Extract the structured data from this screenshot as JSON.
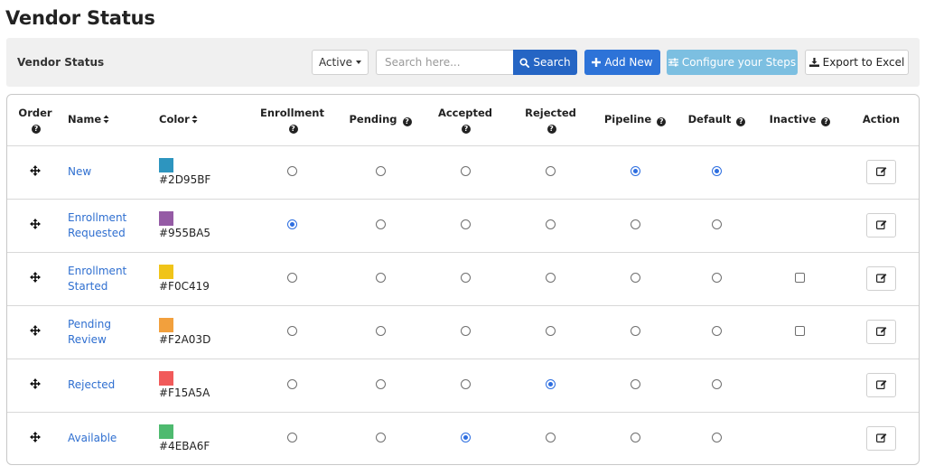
{
  "page": {
    "title": "Vendor Status"
  },
  "toolbar": {
    "label": "Vendor Status",
    "status_filter": "Active",
    "search_placeholder": "Search here...",
    "search_label": "Search",
    "add_new_label": "Add New",
    "configure_label": "Configure your Steps",
    "export_label": "Export to Excel"
  },
  "colors": {
    "primary": "#2565c4",
    "add_new": "#2d73d8",
    "configure": "#7cbfe1",
    "link": "#2f6fd0"
  },
  "table": {
    "headers": {
      "order": "Order",
      "name": "Name",
      "color": "Color",
      "enrollment": "Enrollment",
      "pending": "Pending",
      "accepted": "Accepted",
      "rejected": "Rejected",
      "pipeline": "Pipeline",
      "default": "Default",
      "inactive": "Inactive",
      "action": "Action"
    },
    "rows": [
      {
        "name_line1": "New",
        "name_line2": "",
        "color_hex": "#2D95BF",
        "enrollment": false,
        "pending": false,
        "accepted": false,
        "rejected": false,
        "pipeline": true,
        "default": true,
        "inactive_visible": false
      },
      {
        "name_line1": "Enrollment",
        "name_line2": "Requested",
        "color_hex": "#955BA5",
        "enrollment": true,
        "pending": false,
        "accepted": false,
        "rejected": false,
        "pipeline": false,
        "default": false,
        "inactive_visible": false
      },
      {
        "name_line1": "Enrollment",
        "name_line2": "Started",
        "color_hex": "#F0C419",
        "enrollment": false,
        "pending": false,
        "accepted": false,
        "rejected": false,
        "pipeline": false,
        "default": false,
        "inactive_visible": true
      },
      {
        "name_line1": "Pending",
        "name_line2": "Review",
        "color_hex": "#F2A03D",
        "enrollment": false,
        "pending": false,
        "accepted": false,
        "rejected": false,
        "pipeline": false,
        "default": false,
        "inactive_visible": true
      },
      {
        "name_line1": "Rejected",
        "name_line2": "",
        "color_hex": "#F15A5A",
        "enrollment": false,
        "pending": false,
        "accepted": false,
        "rejected": true,
        "pipeline": false,
        "default": false,
        "inactive_visible": false
      },
      {
        "name_line1": "Available",
        "name_line2": "",
        "color_hex": "#4EBA6F",
        "enrollment": false,
        "pending": false,
        "accepted": true,
        "rejected": false,
        "pipeline": false,
        "default": false,
        "inactive_visible": false
      }
    ]
  }
}
